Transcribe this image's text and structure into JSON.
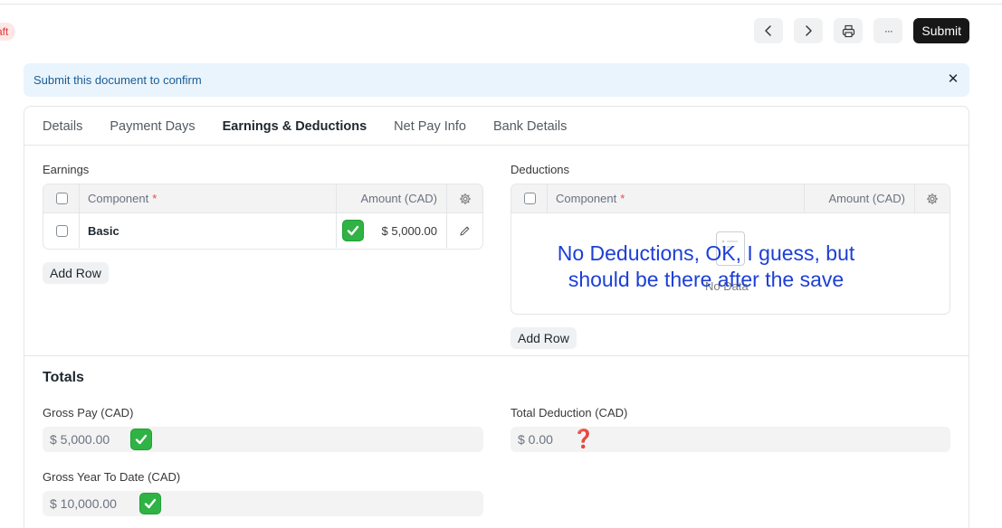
{
  "status": {
    "label": "aft"
  },
  "toolbar": {
    "prev_icon": "chevron-left-icon",
    "next_icon": "chevron-right-icon",
    "print_icon": "printer-icon",
    "more_label": "···",
    "submit_label": "Submit"
  },
  "alert": {
    "message": "Submit this document to confirm",
    "close_label": "✕"
  },
  "tabs": [
    {
      "label": "Details"
    },
    {
      "label": "Payment Days"
    },
    {
      "label": "Earnings & Deductions",
      "active": true
    },
    {
      "label": "Net Pay Info"
    },
    {
      "label": "Bank Details"
    }
  ],
  "earnings": {
    "label": "Earnings",
    "columns": {
      "component": "Component",
      "required": "*",
      "amount": "Amount (CAD)"
    },
    "rows": [
      {
        "component": "Basic",
        "amount": "$ 5,000.00"
      }
    ],
    "add_row": "Add Row"
  },
  "deductions": {
    "label": "Deductions",
    "columns": {
      "component": "Component",
      "required": "*",
      "amount": "Amount (CAD)"
    },
    "empty_text": "No Data",
    "add_row": "Add Row"
  },
  "annotation": {
    "line1": "No Deductions, OK, I guess, but",
    "line2": "should be there after the save"
  },
  "totals": {
    "title": "Totals",
    "gross_pay": {
      "label": "Gross Pay (CAD)",
      "value": "$ 5,000.00"
    },
    "total_deduction": {
      "label": "Total Deduction (CAD)",
      "value": "$ 0.00",
      "mark": "❓"
    },
    "gross_ytd": {
      "label": "Gross Year To Date (CAD)",
      "value": "$ 10,000.00"
    }
  },
  "colors": {
    "accent": "#171717",
    "alert_bg": "#eaf4fc",
    "check_green": "#2fb344",
    "annotation_blue": "#1c3fd6"
  }
}
